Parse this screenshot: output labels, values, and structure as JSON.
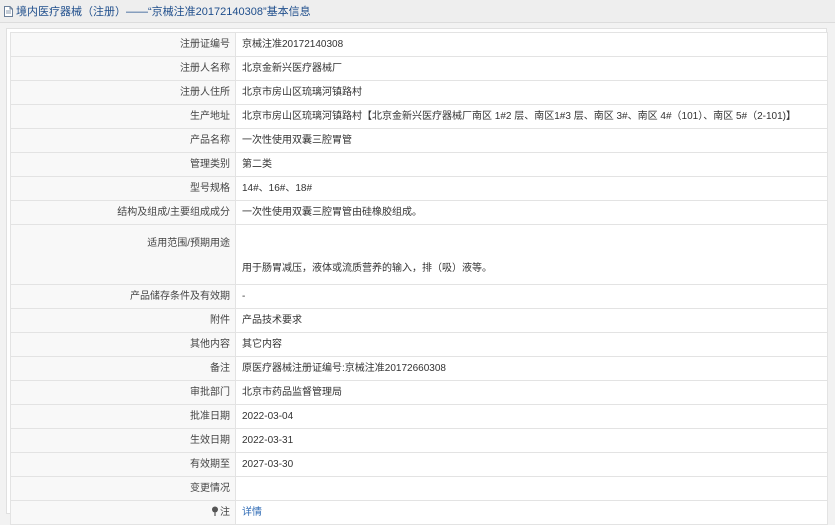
{
  "header": {
    "title": "境内医疗器械（注册）——“京械注准20172140308”基本信息",
    "icon": "document-icon"
  },
  "rows": [
    {
      "label": "注册证编号",
      "value": "京械注准20172140308"
    },
    {
      "label": "注册人名称",
      "value": "北京金新兴医疗器械厂"
    },
    {
      "label": "注册人住所",
      "value": "北京市房山区琉璃河镇路村"
    },
    {
      "label": "生产地址",
      "value": "北京市房山区琉璃河镇路村【北京金新兴医疗器械厂南区 1#2 层、南区1#3 层、南区 3#、南区 4#（101）、南区 5#（2-101)】"
    },
    {
      "label": "产品名称",
      "value": "一次性使用双囊三腔胃管"
    },
    {
      "label": "管理类别",
      "value": "第二类"
    },
    {
      "label": "型号规格",
      "value": "14#、16#、18#"
    },
    {
      "label": "结构及组成/主要组成成分",
      "value": "一次性使用双囊三腔胃管由硅橡胶组成。"
    },
    {
      "label": "适用范围/预期用途",
      "value": "用于肠胃减压，液体或流质营养的输入，排（吸）液等。"
    },
    {
      "label": "产品储存条件及有效期",
      "value": "-"
    },
    {
      "label": "附件",
      "value": "产品技术要求"
    },
    {
      "label": "其他内容",
      "value": "其它内容"
    },
    {
      "label": "备注",
      "value": "原医疗器械注册证编号:京械注准20172660308"
    },
    {
      "label": "审批部门",
      "value": "北京市药品监督管理局"
    },
    {
      "label": "批准日期",
      "value": "2022-03-04"
    },
    {
      "label": "生效日期",
      "value": "2022-03-31"
    },
    {
      "label": "有效期至",
      "value": "2027-03-30"
    },
    {
      "label": "变更情况",
      "value": ""
    }
  ],
  "note_row": {
    "label": "注",
    "icon": "pin-icon",
    "link_text": "详情",
    "link_color": "#2f6bb5"
  }
}
